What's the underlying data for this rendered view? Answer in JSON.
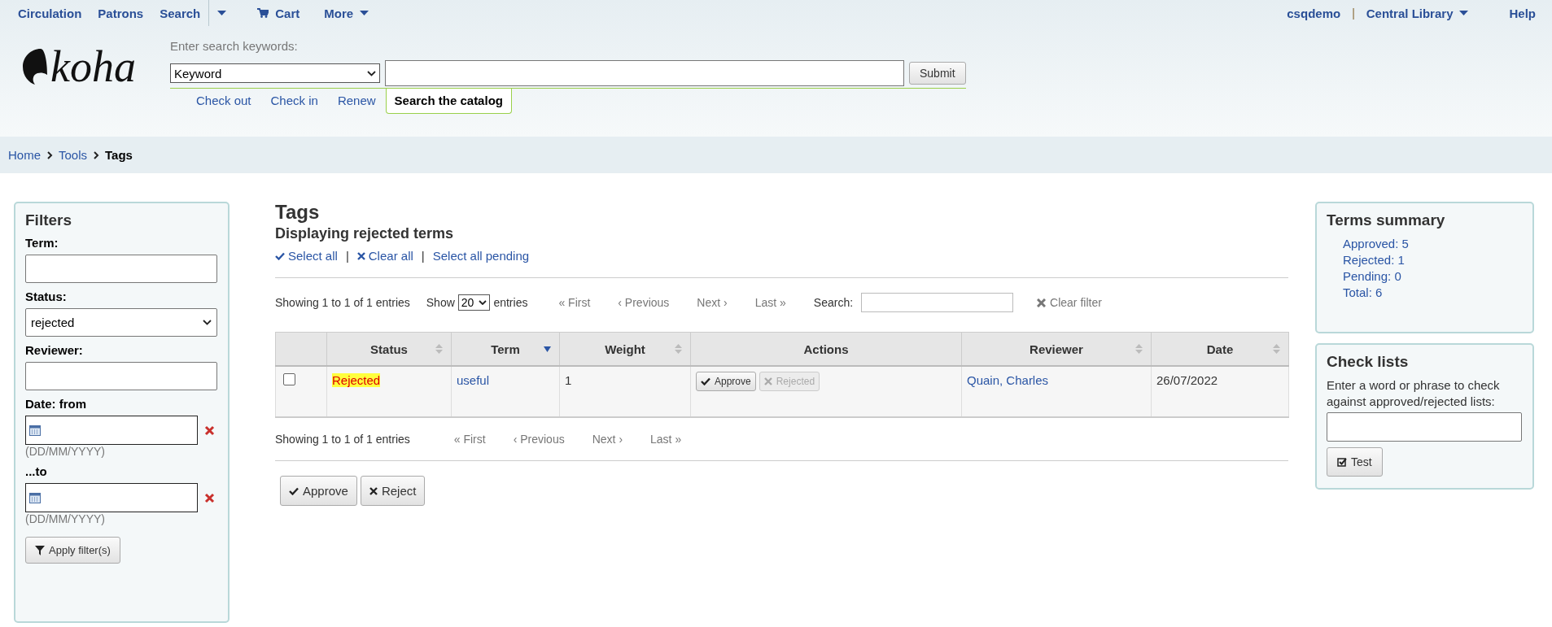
{
  "top_nav": {
    "left": [
      {
        "label": "Circulation",
        "kind": "link"
      },
      {
        "label": "Patrons",
        "kind": "link"
      },
      {
        "label": "Search",
        "kind": "link"
      },
      {
        "kind": "caret"
      },
      {
        "label": "Cart",
        "kind": "cart"
      },
      {
        "label": "More",
        "kind": "menu"
      }
    ],
    "user": "csqdemo",
    "separator": "|",
    "library": "Central Library",
    "help": "Help"
  },
  "logo": "koha",
  "search_header": {
    "prompt": "Enter search keywords:",
    "index_select": "Keyword",
    "submit": "Submit",
    "tabs": [
      {
        "label": "Check out",
        "selected": false
      },
      {
        "label": "Check in",
        "selected": false
      },
      {
        "label": "Renew",
        "selected": false
      },
      {
        "label": "Search the catalog",
        "selected": true
      }
    ]
  },
  "breadcrumbs": [
    {
      "label": "Home",
      "current": false
    },
    {
      "label": "Tools",
      "current": false
    },
    {
      "label": "Tags",
      "current": true
    }
  ],
  "filters": {
    "title": "Filters",
    "fields": [
      {
        "label": "Term:",
        "kind": "text"
      },
      {
        "label": "Status:",
        "kind": "select",
        "value": "rejected"
      },
      {
        "label": "Reviewer:",
        "kind": "text"
      },
      {
        "label": "Date: from",
        "kind": "date",
        "hint": "(DD/MM/YYYY)"
      },
      {
        "label": "...to",
        "kind": "date",
        "hint": "(DD/MM/YYYY)"
      }
    ],
    "apply_button": "Apply filter(s)"
  },
  "main": {
    "title": "Tags",
    "subtitle": "Displaying rejected terms",
    "select_links": [
      {
        "label": "Select all",
        "kind": "select"
      },
      {
        "prefix": "|",
        "label": "Clear all",
        "kind": "clear"
      },
      {
        "prefix": "|",
        "label": "Select all pending",
        "kind": "plain"
      }
    ],
    "info": "Showing 1 to 1 of 1 entries",
    "show_label": "Show",
    "page_size": "20",
    "entries_label": "entries",
    "pager": [
      "« First",
      "‹ Previous",
      "Next ›",
      "Last »"
    ],
    "search_label": "Search:",
    "clear_filter": "Clear filter",
    "table": {
      "columns": [
        {
          "kind": "checkbox"
        },
        {
          "label": "Status",
          "kind": "sortable",
          "sorted": false
        },
        {
          "label": "Term",
          "kind": "sortable",
          "sorted": true
        },
        {
          "label": "Weight",
          "kind": "sortable",
          "sorted": false
        },
        {
          "label": "Actions",
          "kind": "plain"
        },
        {
          "label": "Reviewer",
          "kind": "sortable",
          "sorted": false
        },
        {
          "label": "Date",
          "kind": "sortable",
          "sorted": false
        }
      ],
      "rows": [
        {
          "checked": false,
          "status": "Rejected",
          "highlighted": true,
          "term": "useful",
          "weight": "1",
          "actions": [
            {
              "label": "Approve",
              "kind": "approve",
              "disabled": false
            },
            {
              "label": "Rejected",
              "kind": "reject",
              "disabled": true
            }
          ],
          "reviewer": "Quain, Charles",
          "date": "26/07/2022"
        }
      ]
    },
    "bottom_info": "Showing 1 to 1 of 1 entries",
    "bottom_pager": [
      "« First",
      "‹ Previous",
      "Next ›",
      "Last »"
    ],
    "buttons": [
      {
        "label": "Approve",
        "kind": "approve"
      },
      {
        "label": "Reject",
        "kind": "reject"
      }
    ]
  },
  "summary": {
    "title": "Terms summary",
    "items": [
      {
        "label": "Approved:",
        "count": "5"
      },
      {
        "label": "Rejected:",
        "count": "1"
      },
      {
        "label": "Pending:",
        "count": "0"
      },
      {
        "label": "Total:",
        "count": "6"
      }
    ]
  },
  "check_lists": {
    "title": "Check lists",
    "text": "Enter a word or phrase to check against approved/rejected lists:",
    "button": "Test"
  }
}
